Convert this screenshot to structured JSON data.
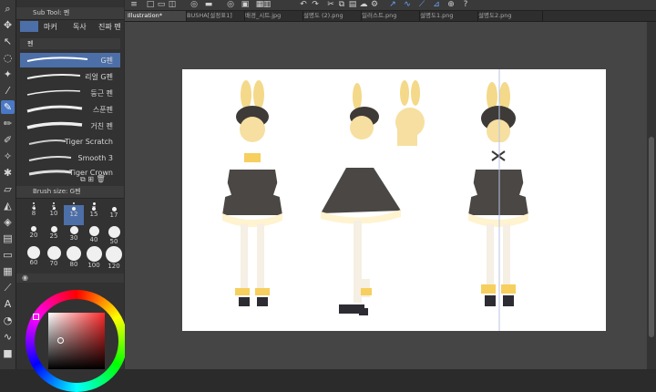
{
  "subtool": {
    "title": "Sub Tool: 펜",
    "tabs": [
      "펜",
      "마커",
      "독사",
      "진짜 펜"
    ],
    "group": "펜",
    "brushes": [
      "G펜",
      "리얼 G펜",
      "둥근 펜",
      "스푼펜",
      "거친 펜",
      "Tiger Scratch",
      "Smooth 3",
      "Tiger Crown"
    ]
  },
  "brushsize": {
    "title": "Brush size: G펜",
    "sizes": [
      "4",
      "5",
      "6",
      "7",
      "8",
      "10",
      "12",
      "15",
      "17",
      "20",
      "25",
      "30",
      "40",
      "50",
      "60",
      "70",
      "80",
      "100",
      "120"
    ],
    "selected": "12"
  },
  "tabs": [
    "Illustration*",
    "BUSHA[설정표1]",
    "배경_시트.jpg",
    "설명도 (2).png",
    "일러스트.png",
    "설명도1.png",
    "설명도2.png"
  ],
  "colors": {
    "accent": "#4d6fa8",
    "canvas_bg": "#454545",
    "main_color": "#ff2a2a"
  }
}
